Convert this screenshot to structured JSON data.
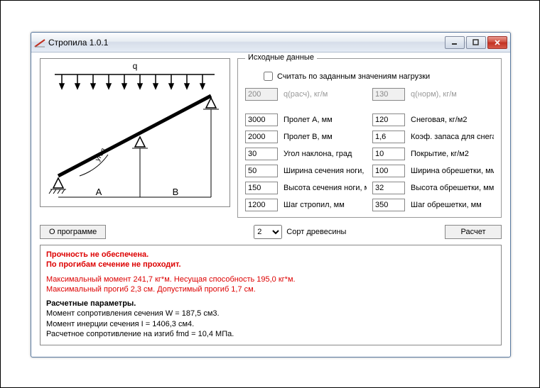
{
  "window": {
    "title": "Стропила 1.0.1"
  },
  "form": {
    "legend": "Исходные данные",
    "checkbox": "Считать по заданным значениям нагрузки",
    "q_calc": "200",
    "q_calc_label": "q(расч), кг/м",
    "q_norm": "130",
    "q_norm_label": "q(норм), кг/м",
    "span_a": "3000",
    "span_a_label": "Пролет А, мм",
    "snow": "120",
    "snow_label": "Снеговая, кг/м2",
    "span_b": "2000",
    "span_b_label": "Пролет В, мм",
    "snow_coef": "1,6",
    "snow_coef_label": "Коэф. запаса для снега",
    "angle": "30",
    "angle_label": "Угол наклона, град",
    "cover": "10",
    "cover_label": "Покрытие, кг/м2",
    "leg_w": "50",
    "leg_w_label": "Ширина сечения ноги, мм",
    "lath_w": "100",
    "lath_w_label": "Ширина обрешетки, мм",
    "leg_h": "150",
    "leg_h_label": "Высота сечения ноги, мм",
    "lath_h": "32",
    "lath_h_label": "Высота обрешетки, мм",
    "rafter_step": "1200",
    "rafter_step_label": "Шаг стропил, мм",
    "lath_step": "350",
    "lath_step_label": "Шаг обрешетки, мм"
  },
  "buttons": {
    "about": "О программе",
    "calc": "Расчет"
  },
  "wood": {
    "label": "Сорт древесины",
    "value": "2"
  },
  "diagram": {
    "q": "q",
    "A": "A",
    "B": "B",
    "angle": "угол"
  },
  "results": {
    "l1": "Прочность не обеспечена.",
    "l2": "По прогибам сечение не проходит.",
    "l3": "Максимальный момент 241,7 кг*м. Несущая способность 195,0 кг*м.",
    "l4": "Максимальный прогиб 2,3 см. Допустимый прогиб 1,7 см.",
    "l5": "Расчетные параметры.",
    "l6": "Момент сопротивления сечения W = 187,5 см3.",
    "l7": "Момент инерции сечения I = 1406,3 см4.",
    "l8": "Расчетное сопротивление на изгиб fmd = 10,4 МПа."
  }
}
